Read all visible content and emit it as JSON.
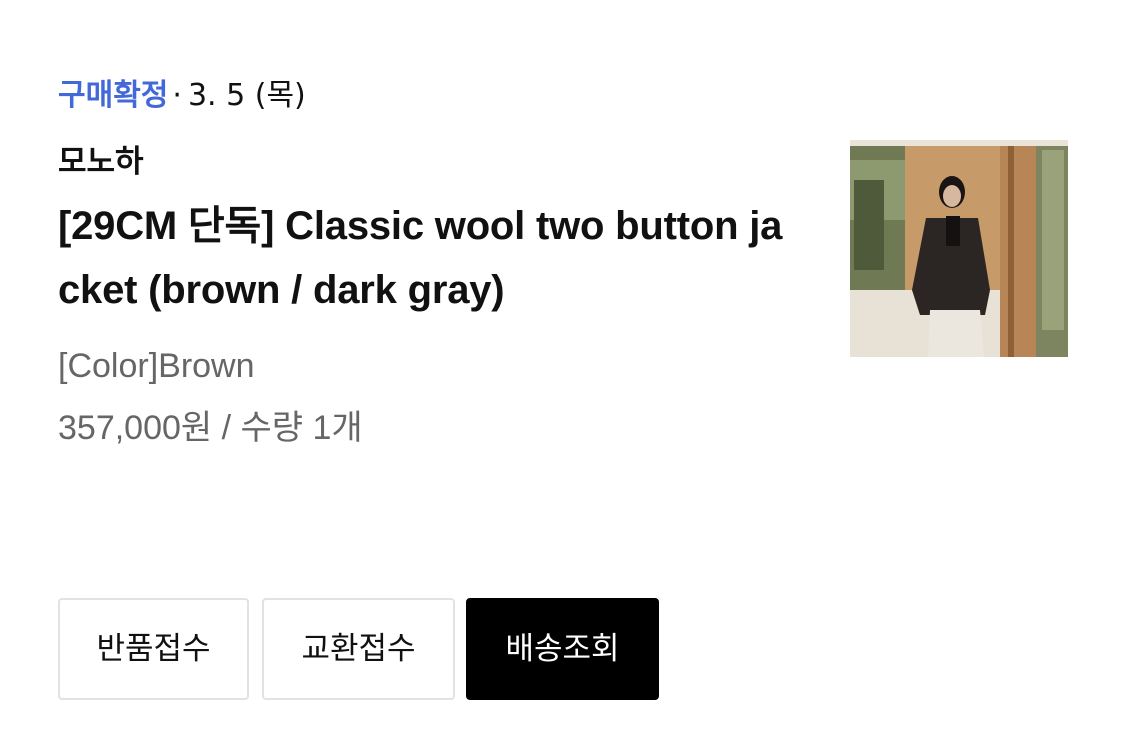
{
  "order": {
    "status": "구매확정",
    "separator": "·",
    "date": "3. 5 (목)",
    "brand": "모노하",
    "title": "[29CM 단독] Classic wool two button jacket (brown / dark gray)",
    "option": "[Color]Brown",
    "price_quantity": "357,000원 / 수량 1개",
    "thumbnail_icon": "product-photo"
  },
  "actions": {
    "return_label": "반품접수",
    "exchange_label": "교환접수",
    "tracking_label": "배송조회"
  },
  "colors": {
    "status_accent": "#4369d9",
    "primary_button": "#000000",
    "secondary_text": "#666666"
  }
}
